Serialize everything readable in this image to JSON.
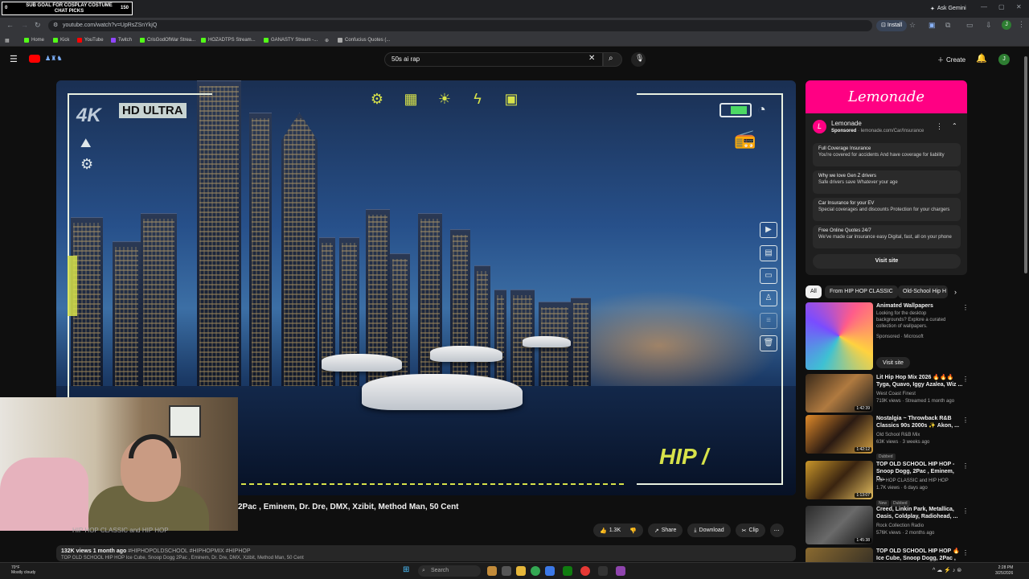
{
  "overlay": {
    "goal_text": "SUB GOAL FOR COSPLAY COSTUME CHAT PICKS",
    "goal_count": "150",
    "goal_start": "0"
  },
  "browser": {
    "ask_gemini": "Ask Gemini",
    "url": "youtube.com/watch?v=UpRsZSnYkjQ",
    "install": "Install",
    "bookmarks": [
      "Home",
      "Kick",
      "YouTube",
      "Twitch",
      "CrisGodOfWar Strea...",
      "HOZADTPS Stream...",
      "GANASTY Stream -...",
      "",
      "Confucius Quotes (..."
    ]
  },
  "youtube": {
    "search_value": "50s ai rap",
    "create": "Create",
    "avatar_letter": "J"
  },
  "video": {
    "badge_4k": "4K",
    "hd_ultra": "HD ULTRA",
    "hip_text": "HIP /",
    "title": "2Pac , Eminem, Dr. Dre, DMX, Xzibit, Method Man, 50 Cent",
    "channel": "HIP HOP CLASSIC and HIP HOP",
    "likes": "1.3K",
    "share": "Share",
    "download": "Download",
    "clip": "Clip",
    "views_meta": "132K views  1 month ago",
    "tags": "#HIPHOPOLDSCHOOL #HIPHOPMIX #HIPHOP",
    "desc_line2": "TOP OLD SCHOOL HIP HOP Ice Cube, Snoop Dogg 2Pac , Eminem, Dr. Dre, DMX, Xzibit, Method Man, 50 Cent"
  },
  "ad": {
    "banner": "Lemonade",
    "brand": "Lemonade",
    "sponsored": "Sponsored",
    "domain": "lemonade.com/Car/Insurance",
    "items": [
      {
        "h": "Full Coverage Insurance",
        "s": "You're covered for accidents And have coverage for liability"
      },
      {
        "h": "Why we love Gen Z drivers",
        "s": "Safe drivers save Whatever your age"
      },
      {
        "h": "Car Insurance for your EV",
        "s": "Special coverages and discounts Protection for your chargers"
      },
      {
        "h": "Free Online Quotes 24/7",
        "s": "We've made car insurance easy Digital, fast, all on your phone"
      }
    ],
    "visit": "Visit site"
  },
  "chips": [
    "All",
    "From HIP HOP CLASSIC",
    "Old-School Hip H"
  ],
  "related": [
    {
      "title": "Animated Wallpapers",
      "channel": "Looking for the desktop backgrounds? Explore a curated collection of wallpapers.",
      "meta": "Sponsored · Microsoft",
      "visit": "Visit site"
    },
    {
      "title": "Lit Hip Hop Mix 2026 🔥🔥🔥 Tyga, Quavo, Iggy Azalea, Wiz ...",
      "channel": "West Coast Finest",
      "meta": "719K views · Streamed 1 month ago",
      "dur": "1:42:39"
    },
    {
      "title": "Nostalgia ~ Throwback R&B Classics 90s 2000s ✨ Akon, ...",
      "channel": "Old School R&B Mix",
      "meta": "63K views · 3 weeks ago",
      "dur": "1:42:12",
      "badge": "Dubbed"
    },
    {
      "title": "TOP OLD SCHOOL HIP HOP - Snoop Dogg, 2Pac , Eminem, D...",
      "channel": "HIP HOP CLASSIC and HIP HOP",
      "meta": "1.7K views · 6 days ago",
      "dur": "1:13:07",
      "badge": "New",
      "badge2": "Dubbed"
    },
    {
      "title": "Creed, Linkin Park, Metallica, Oasis, Coldplay, Radiohead, ...",
      "channel": "Rock Collection Radio",
      "meta": "576K views · 2 months ago",
      "dur": "1:45:38"
    },
    {
      "title": "TOP OLD SCHOOL HIP HOP 🔥 Ice Cube, Snoop Dogg, 2Pac , Emine...",
      "channel": "",
      "meta": ""
    }
  ],
  "taskbar": {
    "weather_temp": "70°F",
    "weather_desc": "Mostly cloudy",
    "search": "Search",
    "time": "2:28 PM",
    "date": "3/25/2026"
  },
  "colors": {
    "accent": "#ff0083",
    "yt_red": "#ff0000",
    "neon": "#d7e24a"
  }
}
